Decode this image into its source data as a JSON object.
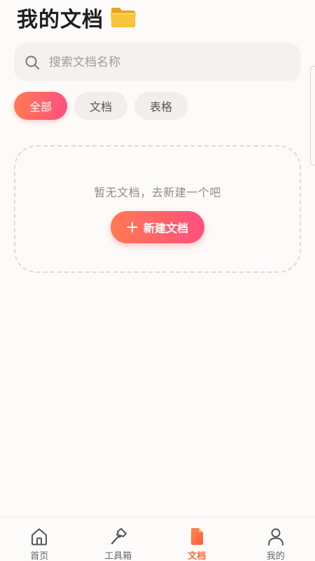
{
  "header": {
    "title": "我的文档",
    "title_icon": "folder-icon"
  },
  "search": {
    "placeholder": "搜索文档名称",
    "value": "",
    "icon": "search-icon"
  },
  "filters": [
    {
      "label": "全部",
      "active": true
    },
    {
      "label": "文档",
      "active": false
    },
    {
      "label": "表格",
      "active": false
    }
  ],
  "empty_state": {
    "message": "暂无文档，去新建一个吧",
    "button_label": "新建文档",
    "button_icon": "plus-icon"
  },
  "tabbar": {
    "items": [
      {
        "label": "首页",
        "icon": "home-icon",
        "active": false
      },
      {
        "label": "工具箱",
        "icon": "hammer-icon",
        "active": false
      },
      {
        "label": "文档",
        "icon": "document-icon",
        "active": true
      },
      {
        "label": "我的",
        "icon": "user-icon",
        "active": false
      }
    ]
  },
  "colors": {
    "accent_start": "#ff7a52",
    "accent_end": "#ff4f7e",
    "active_tab": "#ff6a3d",
    "background": "#fdfbf9"
  }
}
